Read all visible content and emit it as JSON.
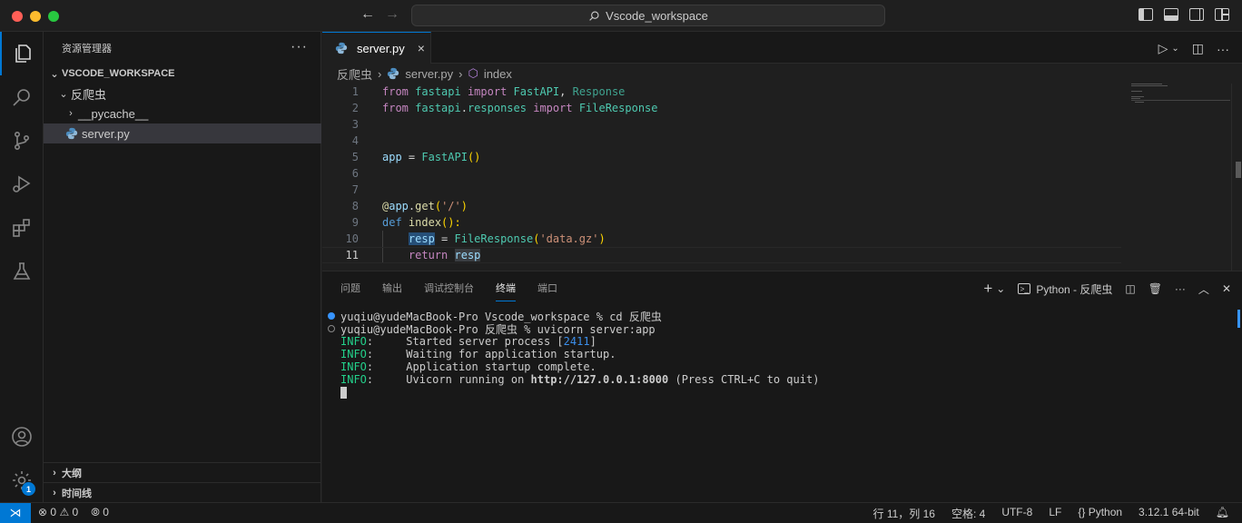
{
  "window": {
    "search_text": "Vscode_workspace",
    "back_icon": "arrow-left-icon",
    "forward_icon": "arrow-right-icon"
  },
  "activity": {
    "items": [
      "explorer-icon",
      "search-icon",
      "source-control-icon",
      "run-debug-icon",
      "extensions-icon",
      "testing-icon"
    ],
    "bottom": [
      "account-icon",
      "settings-icon"
    ],
    "settings_badge": "1"
  },
  "sidebar": {
    "title": "资源管理器",
    "more": "···",
    "workspace": "VSCODE_WORKSPACE",
    "folder": "反爬虫",
    "subfolder": "__pycache__",
    "file": "server.py",
    "outline": "大纲",
    "timeline": "时间线"
  },
  "editor": {
    "tab_label": "server.py",
    "tab_close": "×",
    "breadcrumb": [
      "反爬虫",
      "server.py",
      "index"
    ],
    "lines": [
      "1",
      "2",
      "3",
      "4",
      "5",
      "6",
      "7",
      "8",
      "9",
      "10",
      "11"
    ]
  },
  "code": {
    "l1": {
      "from": "from",
      "mod": "fastapi",
      "import": "import",
      "a": "FastAPI",
      "comma": ",",
      "b": "Response"
    },
    "l2": {
      "from": "from",
      "mod": "fastapi",
      "dot": ".",
      "sub": "responses",
      "import": "import",
      "a": "FileResponse"
    },
    "l5": {
      "var": "app",
      "eq": " = ",
      "cls": "FastAPI",
      "paren": "()"
    },
    "l8": {
      "at": "@",
      "var": "app",
      "dot": ".",
      "fn": "get",
      "open": "(",
      "str": "'/'",
      "close": ")"
    },
    "l9": {
      "def": "def",
      "fn": "index",
      "paren": "():",
      "colon": ""
    },
    "l10": {
      "var": "resp",
      "eq": " = ",
      "cls": "FileResponse",
      "open": "(",
      "str": "'data.gz'",
      "close": ")"
    },
    "l11": {
      "ret": "return",
      "var": "resp"
    }
  },
  "panel": {
    "tabs": [
      "问题",
      "输出",
      "调试控制台",
      "终端",
      "端口"
    ],
    "active_tab": "终端",
    "terminal_name": "Python - 反爬虫",
    "add": "+",
    "dropdown": "⌄"
  },
  "terminal": {
    "l1": "yuqiu@yudeMacBook-Pro Vscode_workspace % cd 反爬虫",
    "l2": "yuqiu@yudeMacBook-Pro 反爬虫 % uvicorn server:app",
    "info_label": "INFO",
    "info_colon": ":",
    "l3_pre": "     Started server process [",
    "l3_num": "2411",
    "l3_post": "]",
    "l4": "     Waiting for application startup.",
    "l5": "     Application startup complete.",
    "l6_pre": "     Uvicorn running on ",
    "l6_url": "http://127.0.0.1:8000",
    "l6_post": " (Press CTRL+C to quit)"
  },
  "status": {
    "errors": "0",
    "warnings": "0",
    "ports": "0",
    "position": "行 11，列 16",
    "spaces": "空格: 4",
    "encoding": "UTF-8",
    "eol": "LF",
    "language": "Python",
    "interpreter": "3.12.1 64-bit"
  }
}
